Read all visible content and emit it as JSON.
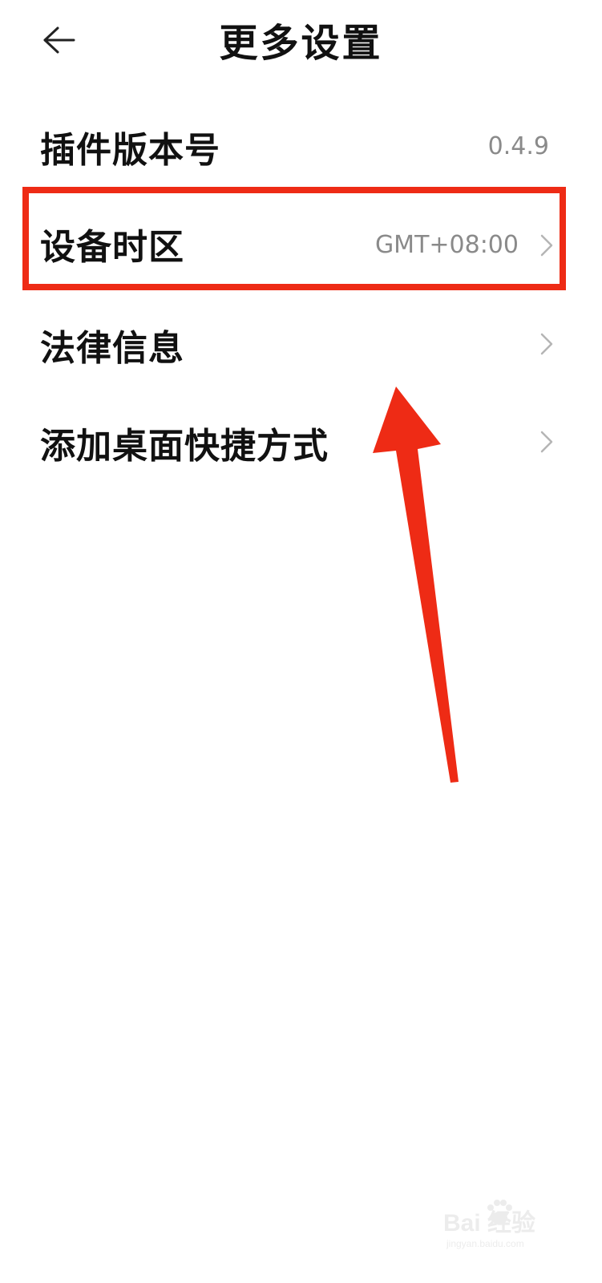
{
  "header": {
    "title": "更多设置",
    "back_icon": "arrow-left-icon"
  },
  "settings": {
    "items": [
      {
        "label": "插件版本号",
        "value": "0.4.9",
        "has_chevron": false
      },
      {
        "label": "设备时区",
        "value": "GMT+08:00",
        "has_chevron": true
      },
      {
        "label": "法律信息",
        "value": "",
        "has_chevron": true
      },
      {
        "label": "添加桌面快捷方式",
        "value": "",
        "has_chevron": true
      }
    ]
  },
  "annotation": {
    "highlight_color": "#ee2b15",
    "highlighted_item": "设备时区",
    "arrow_color": "#ee2b15"
  },
  "watermark": {
    "text": "Bai 经验",
    "subtext": "jingyan.baidu.com"
  },
  "colors": {
    "background": "#ffffff",
    "text_primary": "#111111",
    "text_secondary": "#8a8a8a",
    "chevron": "#b5b5b5"
  }
}
